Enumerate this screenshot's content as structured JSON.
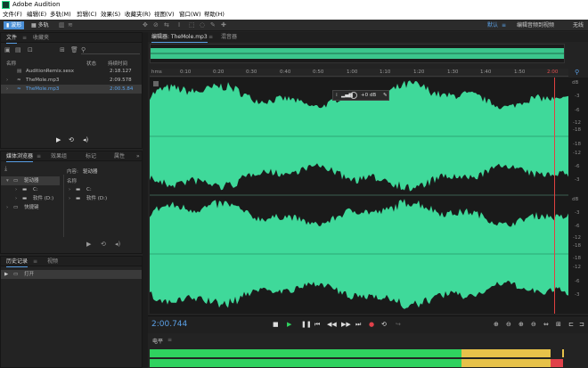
{
  "app": {
    "title": "Adobe Audition"
  },
  "menu": [
    "文件(F)",
    "编辑(E)",
    "多轨(M)",
    "剪辑(C)",
    "效果(S)",
    "收藏夹(R)",
    "视图(V)",
    "窗口(W)",
    "帮助(H)"
  ],
  "toolbar": {
    "wave_label": "波形",
    "multitrack_label": "多轨",
    "workspace_default": "默认",
    "workspace_edit_audio_video": "编辑音频到视频",
    "workspace_no_line": "无线"
  },
  "files_panel": {
    "tabs": [
      "文件",
      "收藏夹"
    ],
    "columns": {
      "name": "名称",
      "status": "状态",
      "duration": "持续时间"
    },
    "rows": [
      {
        "name": "AuditionRemix.sesx",
        "duration": "2:18.127"
      },
      {
        "name": "TheMole.mp3",
        "duration": "2:09.578"
      },
      {
        "name": "TheMole.mp3",
        "duration": "2:00.5.84",
        "selected": true
      }
    ]
  },
  "media_panel": {
    "tabs": [
      "媒体浏览器",
      "效果组",
      "标记",
      "属性"
    ],
    "content_label": "内容:",
    "content_value": "驱动器",
    "name_col": "名称",
    "tree": [
      {
        "label": "驱动器",
        "level": 0,
        "selected": true
      },
      {
        "label": "C:",
        "level": 1
      },
      {
        "label": "软件 (D:)",
        "level": 1
      },
      {
        "label": "快捷键",
        "level": 0
      }
    ],
    "list": [
      {
        "label": "C:"
      },
      {
        "label": "软件 (D:)"
      }
    ]
  },
  "history_panel": {
    "tabs": [
      "历史记录",
      "视频"
    ],
    "items": [
      "打开"
    ]
  },
  "editor": {
    "tabs": [
      "编辑器: TheMole.mp3",
      "混音器"
    ],
    "ruler_labels": [
      "hms",
      "0:10",
      "0:20",
      "0:30",
      "0:40",
      "0:50",
      "1:00",
      "1:10",
      "1:20",
      "1:30",
      "1:40",
      "1:50",
      "2:00"
    ],
    "hud_volume": "+0 dB",
    "db_top": [
      "dB",
      "-3",
      "-6",
      "-12",
      "-18",
      "-18",
      "-12",
      "-6",
      "-3"
    ],
    "db_bottom": [
      "dB",
      "-3",
      "-6",
      "-12",
      "-18",
      "-18",
      "-12",
      "-6",
      "-3"
    ],
    "playhead_fraction": 0.965
  },
  "transport": {
    "time": "2:00.744"
  },
  "levels": {
    "title": "电平"
  },
  "colors": {
    "waveform": "#3fd99a",
    "waveform_bg": "#1a1a1a",
    "accent_blue": "#4a8fd6",
    "level_green": "#2fd25f",
    "level_yellow": "#e7c24a",
    "level_red": "#e0414a"
  }
}
